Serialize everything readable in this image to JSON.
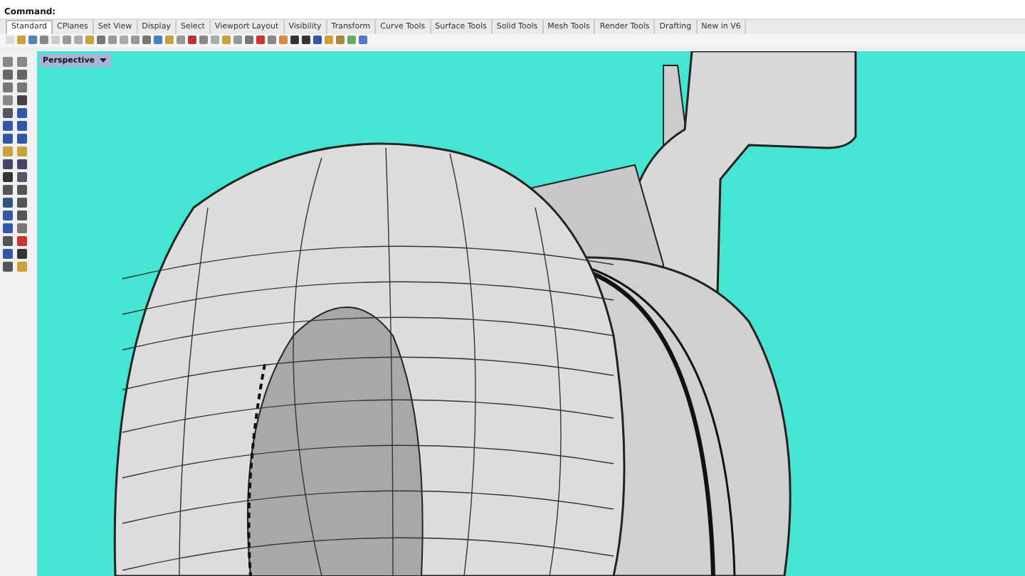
{
  "command_line": {
    "prompt": "Command:"
  },
  "tabs": [
    {
      "label": "Standard",
      "selected": true
    },
    {
      "label": "CPlanes",
      "selected": false
    },
    {
      "label": "Set View",
      "selected": false
    },
    {
      "label": "Display",
      "selected": false
    },
    {
      "label": "Select",
      "selected": false
    },
    {
      "label": "Viewport Layout",
      "selected": false
    },
    {
      "label": "Visibility",
      "selected": false
    },
    {
      "label": "Transform",
      "selected": false
    },
    {
      "label": "Curve Tools",
      "selected": false
    },
    {
      "label": "Surface Tools",
      "selected": false
    },
    {
      "label": "Solid Tools",
      "selected": false
    },
    {
      "label": "Mesh Tools",
      "selected": false
    },
    {
      "label": "Render Tools",
      "selected": false
    },
    {
      "label": "Drafting",
      "selected": false
    },
    {
      "label": "New in V6",
      "selected": false
    }
  ],
  "viewport": {
    "title": "Perspective"
  }
}
